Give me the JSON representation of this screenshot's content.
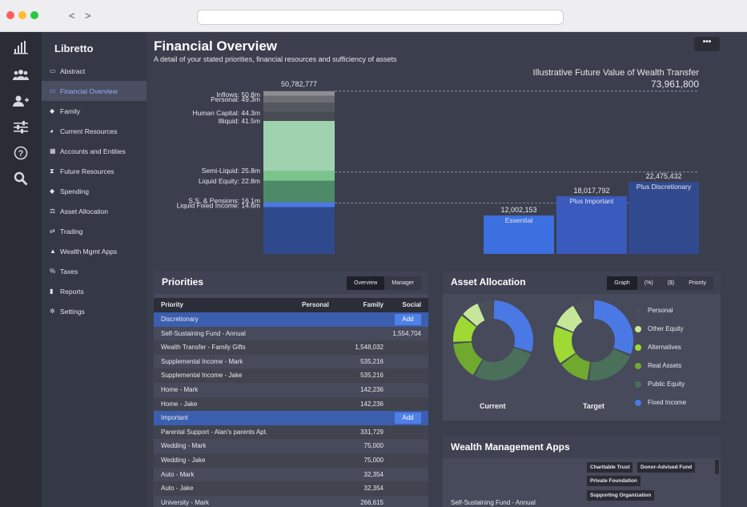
{
  "app": {
    "brand": "Libretto"
  },
  "browser": {
    "back": "<",
    "forward": ">"
  },
  "sidebar": {
    "items": [
      {
        "label": "Abstract",
        "icon": "abstract-icon"
      },
      {
        "label": "Financial Overview",
        "icon": "overview-icon"
      },
      {
        "label": "Family",
        "icon": "family-icon"
      },
      {
        "label": "Current Resources",
        "icon": "pie-icon"
      },
      {
        "label": "Accounts and Entities",
        "icon": "building-icon"
      },
      {
        "label": "Future Resources",
        "icon": "hourglass-icon"
      },
      {
        "label": "Spending",
        "icon": "tag-icon"
      },
      {
        "label": "Asset Allocation",
        "icon": "balance-icon"
      },
      {
        "label": "Trading",
        "icon": "exchange-icon"
      },
      {
        "label": "Wealth Mgmt Apps",
        "icon": "sitemap-icon"
      },
      {
        "label": "Taxes",
        "icon": "percent-icon"
      },
      {
        "label": "Reports",
        "icon": "file-icon"
      },
      {
        "label": "Settings",
        "icon": "gear-icon"
      }
    ]
  },
  "header": {
    "title": "Financial Overview",
    "subtitle": "A detail of your stated priorities, financial resources and sufficiency of assets",
    "more": "•••"
  },
  "chart_data": {
    "type": "bar",
    "title": "Illustrative Future Value of Wealth Transfer",
    "total": "73,961,800",
    "resources_total": "50,782,777",
    "resource_labels": [
      "Inflows: 50.8m",
      "Personal: 49.3m",
      "Human Capital: 44.3m",
      "Illiquid: 41.5m",
      "Semi-Liquid: 25.8m",
      "Liquid Equity: 22.8m",
      "S.S. & Pensions: 16.1m",
      "Liquid Fixed Income: 14.6m"
    ],
    "resource_values": [
      50.8,
      49.3,
      44.3,
      41.5,
      25.8,
      22.8,
      16.1,
      14.6
    ],
    "categories": [
      "Essential",
      "Plus Important",
      "Plus Discretionary"
    ],
    "value_labels": [
      "12,002,153",
      "18,017,792",
      "22,475,432"
    ],
    "values": [
      12002153,
      18017792,
      22475432
    ],
    "colors": {
      "essential": "#3c6fe0",
      "important": "#3a5bbd",
      "discretionary": "#314a8f",
      "liquid_equity": "#4d8a68",
      "semi": "#7bc48c",
      "illiquid": "#9fd3b0",
      "fixed": "#2f4a8c"
    }
  },
  "priorities": {
    "title": "Priorities",
    "tabs": [
      "Overview",
      "Manager"
    ],
    "columns": [
      "Priority",
      "Personal",
      "Family",
      "Social"
    ],
    "add_label": "Add",
    "rows": [
      {
        "kind": "cat",
        "name": "Discretionary",
        "family": "",
        "social": ""
      },
      {
        "kind": "row",
        "name": "Self-Sustaining Fund - Annual",
        "family": "",
        "social": "1,554,704"
      },
      {
        "kind": "row",
        "name": "Wealth Transfer - Family Gifts",
        "family": "1,548,032",
        "social": ""
      },
      {
        "kind": "row",
        "name": "Supplemental Income - Mark",
        "family": "535,216",
        "social": ""
      },
      {
        "kind": "row",
        "name": "Supplemental Income - Jake",
        "family": "535,216",
        "social": ""
      },
      {
        "kind": "row",
        "name": "Home - Mark",
        "family": "142,236",
        "social": ""
      },
      {
        "kind": "row",
        "name": "Home - Jake",
        "family": "142,236",
        "social": ""
      },
      {
        "kind": "cat",
        "name": "Important",
        "family": "",
        "social": ""
      },
      {
        "kind": "row",
        "name": "Parental Support - Alan's parents Apt.",
        "family": "331,729",
        "social": ""
      },
      {
        "kind": "row",
        "name": "Wedding - Mark",
        "family": "75,000",
        "social": ""
      },
      {
        "kind": "row",
        "name": "Wedding - Jake",
        "family": "75,000",
        "social": ""
      },
      {
        "kind": "row",
        "name": "Auto - Mark",
        "family": "32,354",
        "social": ""
      },
      {
        "kind": "row",
        "name": "Auto - Jake",
        "family": "32,354",
        "social": ""
      },
      {
        "kind": "row",
        "name": "University - Mark",
        "family": "266,615",
        "social": ""
      }
    ]
  },
  "allocation": {
    "title": "Asset Allocation",
    "tabs": [
      "Graph",
      "(%)",
      "($)",
      "Priority"
    ],
    "current_label": "Current",
    "target_label": "Target",
    "legend": [
      {
        "label": "Personal",
        "color": "#4b4f5b"
      },
      {
        "label": "Other Equity",
        "color": "#c6e79a"
      },
      {
        "label": "Alternatives",
        "color": "#9ed934"
      },
      {
        "label": "Real Assets",
        "color": "#6faa2e"
      },
      {
        "label": "Public Equity",
        "color": "#4a6f5a"
      },
      {
        "label": "Fixed Income",
        "color": "#4a79e6"
      }
    ],
    "current": [
      0.3,
      0.28,
      0.16,
      0.12,
      0.08,
      0.06
    ],
    "target": [
      0.31,
      0.21,
      0.13,
      0.16,
      0.11,
      0.08
    ]
  },
  "apps": {
    "title": "Wealth Management Apps",
    "row_label": "Self-Sustaining Fund - Annual",
    "tags": [
      "Charitable Trust",
      "Donor-Advised Fund",
      "Private Foundation",
      "Supporting Organization"
    ]
  }
}
